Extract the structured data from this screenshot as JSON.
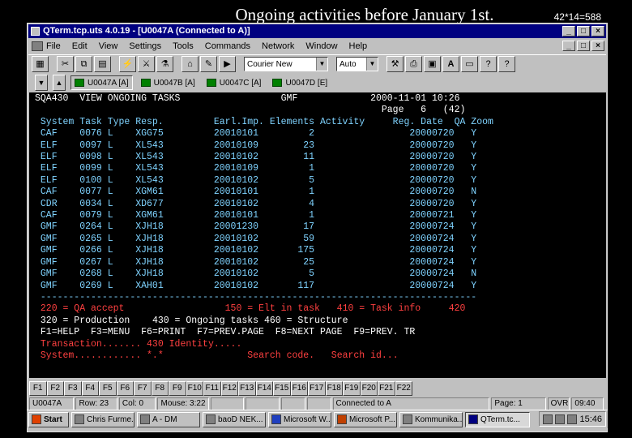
{
  "slide": {
    "title": "Ongoing activities before January 1st.",
    "note": "42*14=588"
  },
  "window": {
    "title": "QTerm.tcp.uts 4.0.19 - [U0047A (Connected to A)]",
    "menu": [
      "File",
      "Edit",
      "View",
      "Settings",
      "Tools",
      "Commands",
      "Network",
      "Window",
      "Help"
    ]
  },
  "toolbar": {
    "font_select": "Courier New",
    "size_select": "Auto"
  },
  "sessions": [
    "U0047A [A]",
    "U0047B [A]",
    "U0047C [A]",
    "U0047D [E]"
  ],
  "screen": {
    "header_left": "SQA430  VIEW ONGOING TASKS",
    "header_mid": "GMF",
    "header_right": "2000-11-01 10:26",
    "page_line": "Page   6   (42)",
    "columns": [
      "System",
      "Task",
      "Type",
      "Resp.",
      "Earl.Imp.",
      "Elements",
      "Activity",
      "Reg. Date",
      "QA",
      "Zoom"
    ],
    "rows": [
      [
        "CAF",
        "0076",
        "L",
        "XGG75",
        "20010101",
        "2",
        "20000720",
        "Y"
      ],
      [
        "ELF",
        "0097",
        "L",
        "XL543",
        "20010109",
        "23",
        "20000720",
        "Y"
      ],
      [
        "ELF",
        "0098",
        "L",
        "XL543",
        "20010102",
        "11",
        "20000720",
        "Y"
      ],
      [
        "ELF",
        "0099",
        "L",
        "XL543",
        "20010109",
        "1",
        "20000720",
        "Y"
      ],
      [
        "ELF",
        "0100",
        "L",
        "XL543",
        "20010102",
        "5",
        "20000720",
        "Y"
      ],
      [
        "CAF",
        "0077",
        "L",
        "XGM61",
        "20010101",
        "1",
        "20000720",
        "N"
      ],
      [
        "CDR",
        "0034",
        "L",
        "XD677",
        "20010102",
        "4",
        "20000720",
        "Y"
      ],
      [
        "CAF",
        "0079",
        "L",
        "XGM61",
        "20010101",
        "1",
        "20000721",
        "Y"
      ],
      [
        "GMF",
        "0264",
        "L",
        "XJH18",
        "20001230",
        "17",
        "20000724",
        "Y"
      ],
      [
        "GMF",
        "0265",
        "L",
        "XJH18",
        "20010102",
        "59",
        "20000724",
        "Y"
      ],
      [
        "GMF",
        "0266",
        "L",
        "XJH18",
        "20010102",
        "175",
        "20000724",
        "Y"
      ],
      [
        "GMF",
        "0267",
        "L",
        "XJH18",
        "20010102",
        "25",
        "20000724",
        "Y"
      ],
      [
        "GMF",
        "0268",
        "L",
        "XJH18",
        "20010102",
        "5",
        "20000724",
        "N"
      ],
      [
        "GMF",
        "0269",
        "L",
        "XAH01",
        "20010102",
        "117",
        "20000724",
        "Y"
      ]
    ],
    "divider": "------------------------------------------------------------------------------",
    "cmd1": "220 = QA accept",
    "cmd2": "150 = Elt in task",
    "cmd3": "410 = Task info",
    "cmd4": "420",
    "cmd5": "320 = Production",
    "cmd6": "430 = Ongoing tasks 460 = Structure",
    "fkeys_line": "F1=HELP  F3=MENU  F6=PRINT  F7=PREV.PAGE  F8=NEXT PAGE  F9=PREV. TR",
    "transaction_label": "Transaction.......",
    "transaction_value": "430",
    "identity_label": "Identity.....",
    "system_label": "System............",
    "system_value": "*.*",
    "search_code": "Search code.",
    "search_id": "Search id..."
  },
  "function_keys": [
    "F1",
    "F2",
    "F3",
    "F4",
    "F5",
    "F6",
    "F7",
    "F8",
    "F9",
    "F10",
    "F11",
    "F12",
    "F13",
    "F14",
    "F15",
    "F16",
    "F17",
    "F18",
    "F19",
    "F20",
    "F21",
    "F22"
  ],
  "status": {
    "session": "U0047A",
    "row": "Row: 23",
    "col": "Col: 0",
    "mouse": "Mouse: 3:22",
    "connection": "Connected to A",
    "page": "Page: 1",
    "mode": "OVR",
    "time": "09:40"
  },
  "taskbar": {
    "start": "Start",
    "items": [
      "Chris Furme...",
      "A - DM",
      "baoD NEK...",
      "Microsoft W...",
      "Microsoft P...",
      "Kommunika...",
      "QTerm.tc..."
    ],
    "clock": "15:46"
  }
}
